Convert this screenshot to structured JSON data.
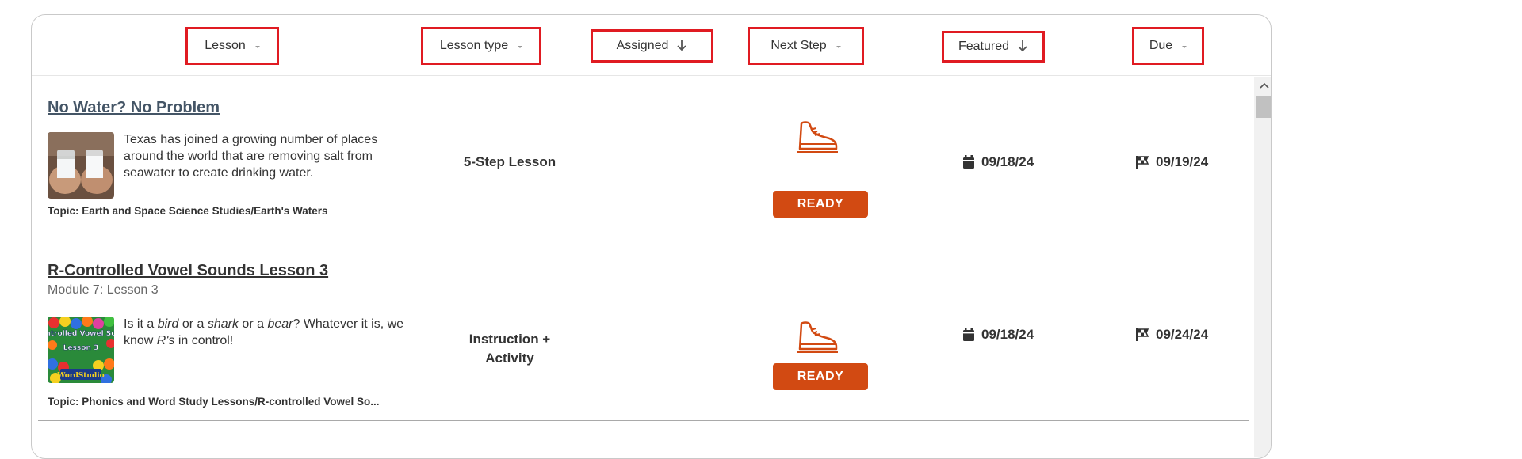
{
  "columns": {
    "lesson": "Lesson",
    "lesson_type": "Lesson type",
    "assigned": "Assigned",
    "next_step": "Next Step",
    "featured": "Featured",
    "due": "Due"
  },
  "rows": [
    {
      "title": "No Water? No Problem",
      "subtitle": "",
      "description": "Texas has joined a growing number of places around the world that are removing salt from seawater to create drinking water.",
      "topic": "Topic: Earth and Space Science Studies/Earth's Waters",
      "lesson_type": "5-Step Lesson",
      "next_step": "READY",
      "featured": "09/18/24",
      "due": "09/19/24"
    },
    {
      "title": "R-Controlled Vowel Sounds Lesson 3",
      "subtitle": "Module 7: Lesson 3",
      "description_parts": {
        "p1": "Is it a ",
        "p2": "bird",
        "p3": " or a ",
        "p4": "shark",
        "p5": " or a ",
        "p6": "bear",
        "p7": "? Whatever it is, we know ",
        "p8": "R's",
        "p9": " in control!"
      },
      "thumb_text": {
        "line1": "ontrolled Vowel Sou",
        "line2": "Lesson 3",
        "line3": "WordStudio"
      },
      "topic": "Topic: Phonics and Word Study Lessons/R-controlled Vowel So...",
      "lesson_type": "Instruction + Activity",
      "next_step": "READY",
      "featured": "09/18/24",
      "due": "09/24/24"
    }
  ],
  "icons": {
    "sort_arrow": "arrow-down-icon",
    "caret": "caret-down-icon",
    "calendar": "calendar-icon",
    "finish_flag": "checkered-flag-icon",
    "next_step": "running-shoe-icon",
    "scroll_up": "chevron-up-icon"
  },
  "colors": {
    "highlight_border": "#e01b22",
    "ready_button": "#d24a12",
    "title_row1": "#445566",
    "title_row2": "#333333"
  }
}
